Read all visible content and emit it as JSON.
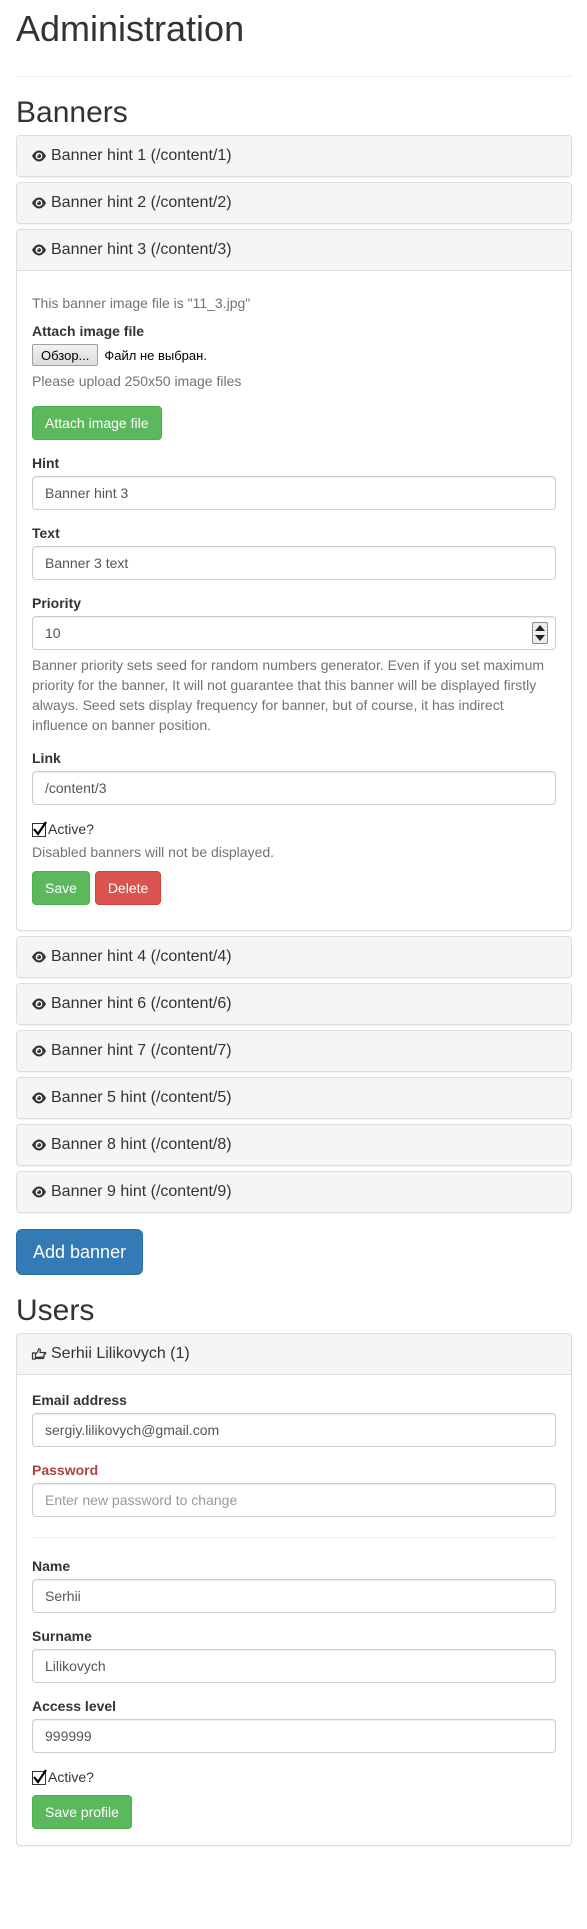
{
  "page": {
    "title": "Administration"
  },
  "banners": {
    "title": "Banners",
    "items": [
      {
        "label": "Banner hint 1 (/content/1)"
      },
      {
        "label": "Banner hint 2 (/content/2)"
      },
      {
        "label": "Banner hint 3 (/content/3)"
      },
      {
        "label": "Banner hint 4 (/content/4)"
      },
      {
        "label": "Banner hint 6 (/content/6)"
      },
      {
        "label": "Banner hint 7 (/content/7)"
      },
      {
        "label": "Banner 5 hint (/content/5)"
      },
      {
        "label": "Banner 8 hint (/content/8)"
      },
      {
        "label": "Banner 9 hint (/content/9)"
      }
    ],
    "header_icon": "eye-icon",
    "open_form": {
      "file_info": "This banner image file is \"11_3.jpg\"",
      "attach_label": "Attach image file",
      "browse_button": "Обзор...",
      "no_file": "Файл не выбран.",
      "upload_help": "Please upload 250x50 image files",
      "attach_button": "Attach image file",
      "hint_label": "Hint",
      "hint_value": "Banner hint 3",
      "text_label": "Text",
      "text_value": "Banner 3 text",
      "priority_label": "Priority",
      "priority_value": "10",
      "priority_help": "Banner priority sets seed for random numbers generator. Even if you set maximum priority for the banner, It will not guarantee that this banner will be displayed firstly always. Seed sets display frequency for banner, but of course, it has indirect influence on banner position.",
      "link_label": "Link",
      "link_value": "/content/3",
      "active_label": "Active?",
      "active_checked": true,
      "active_help": "Disabled banners will not be displayed.",
      "save_button": "Save",
      "delete_button": "Delete"
    },
    "add_button": "Add banner"
  },
  "users": {
    "title": "Users",
    "header_icon": "hand-point-right-icon",
    "user_label": "Serhii Lilikovych (1)",
    "form": {
      "email_label": "Email address",
      "email_value": "sergiy.lilikovych@gmail.com",
      "password_label": "Password",
      "password_placeholder": "Enter new password to change",
      "name_label": "Name",
      "name_value": "Serhii",
      "surname_label": "Surname",
      "surname_value": "Lilikovych",
      "access_label": "Access level",
      "access_value": "999999",
      "active_label": "Active?",
      "active_checked": true,
      "save_button": "Save profile"
    }
  },
  "colors": {
    "success": "#5cb85c",
    "danger": "#d9534f",
    "primary": "#337ab7",
    "error_label": "#a94442",
    "panel_heading_bg": "#f5f5f5"
  }
}
